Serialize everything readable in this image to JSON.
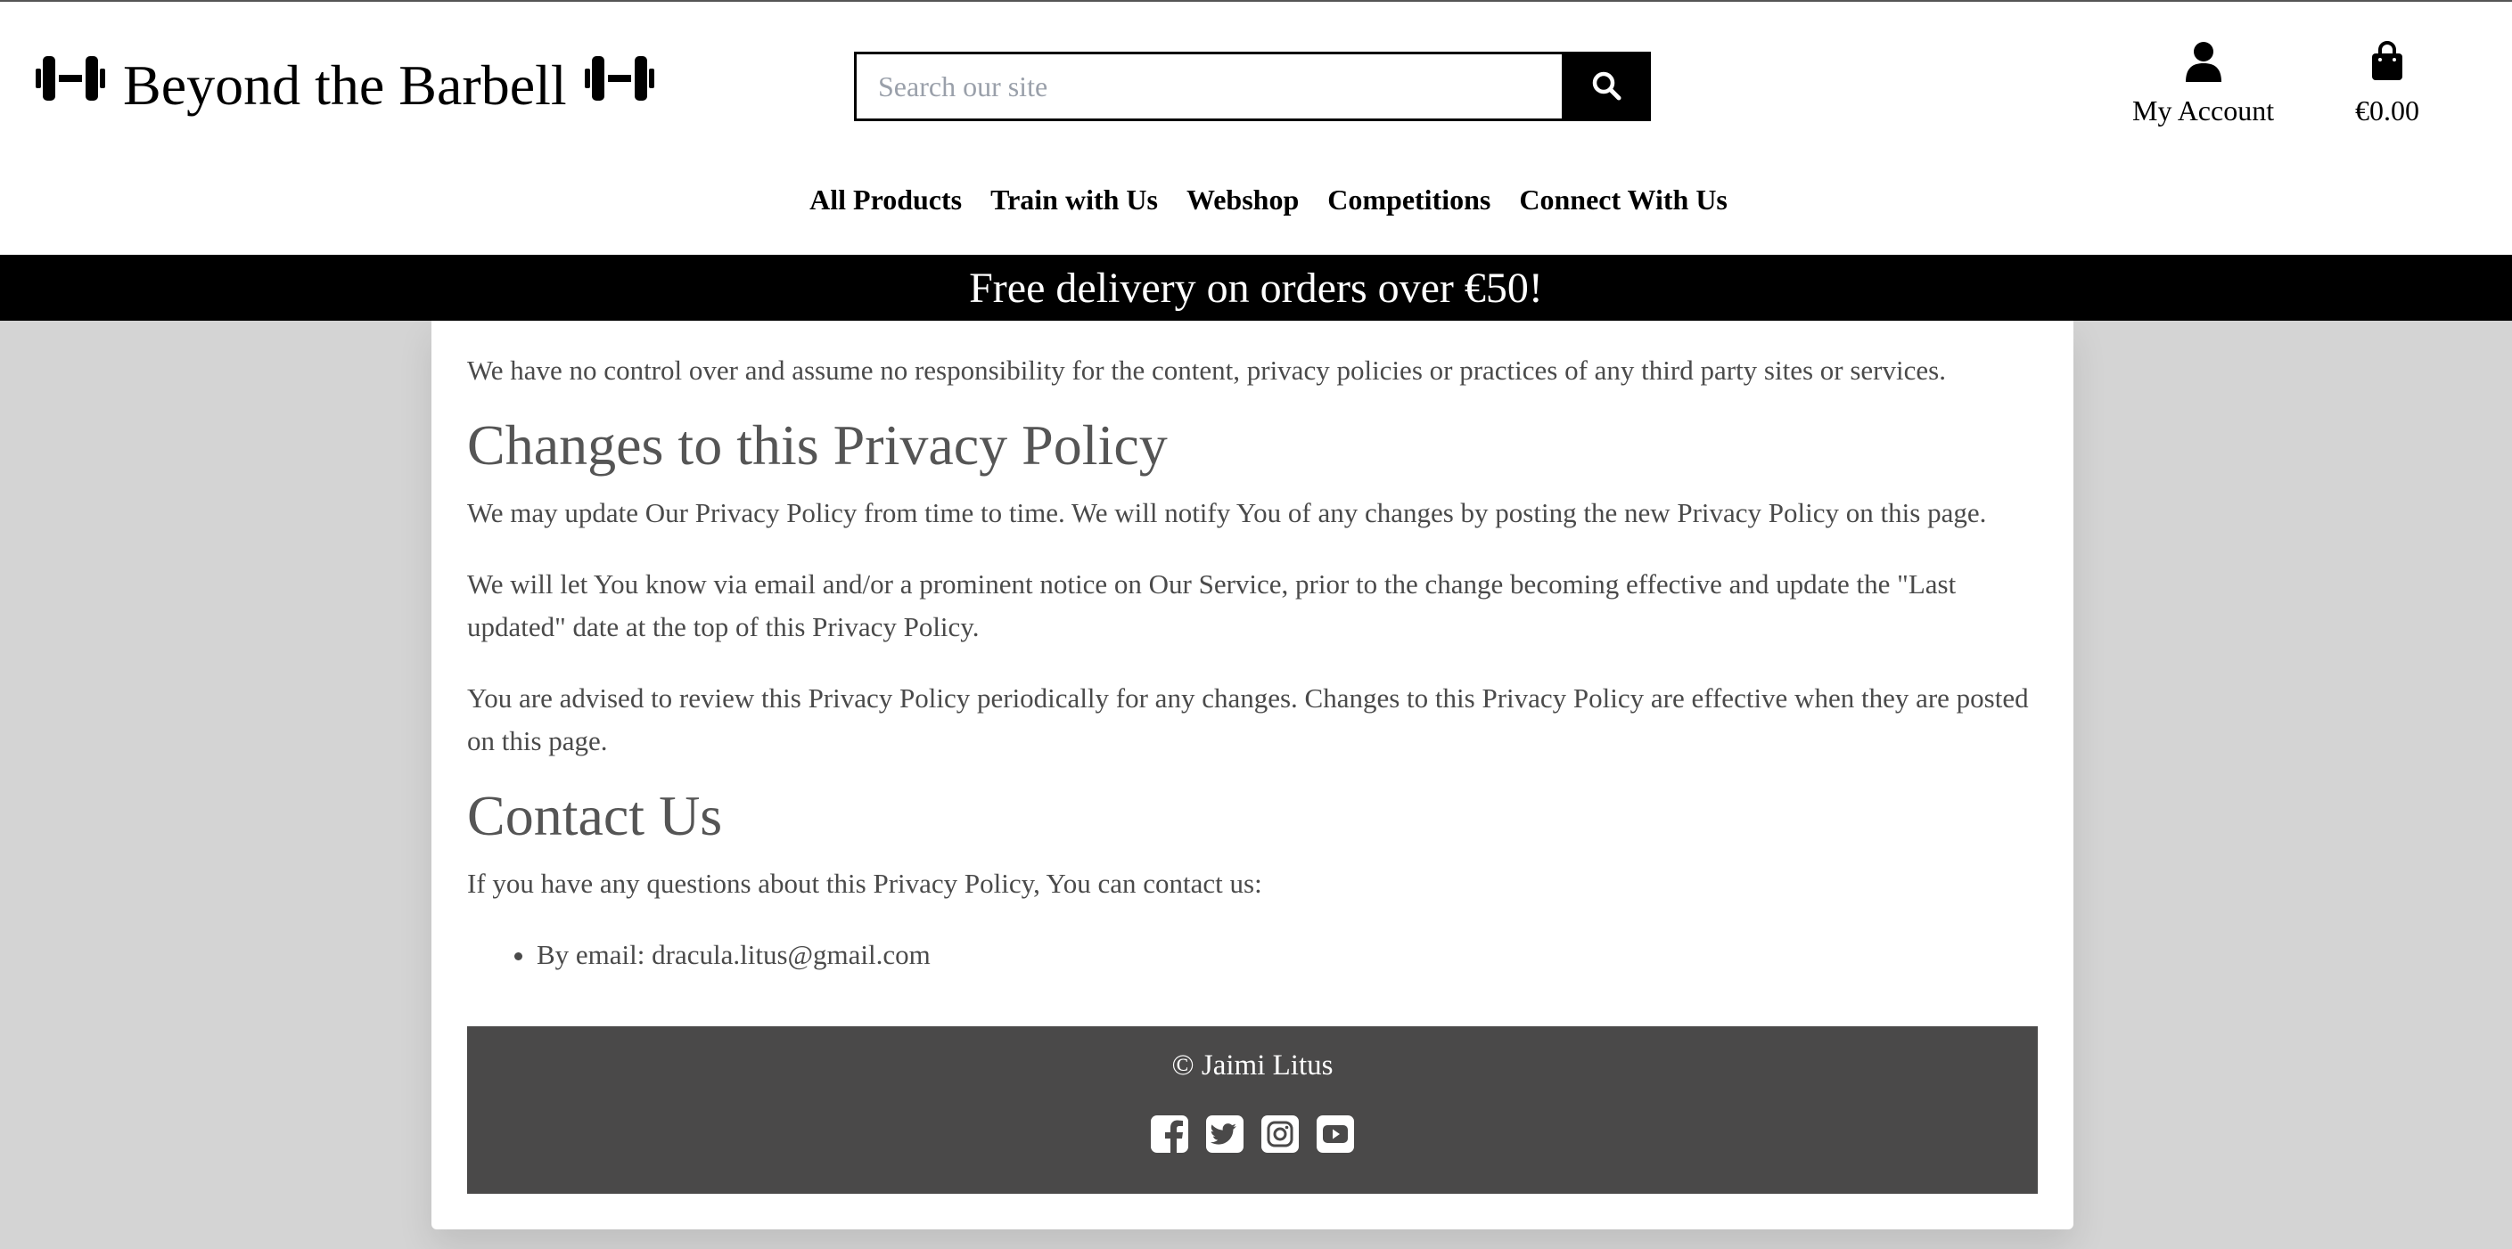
{
  "header": {
    "brand": "Beyond the Barbell",
    "search_placeholder": "Search our site",
    "account_label": "My Account",
    "cart_total": "€0.00"
  },
  "nav": {
    "items": [
      "All Products",
      "Train with Us",
      "Webshop",
      "Competitions",
      "Connect With Us"
    ]
  },
  "banner": "Free delivery on orders over €50!",
  "content": {
    "intro": "We have no control over and assume no responsibility for the content, privacy policies or practices of any third party sites or services.",
    "changes_heading": "Changes to this Privacy Policy",
    "changes_p1": "We may update Our Privacy Policy from time to time. We will notify You of any changes by posting the new Privacy Policy on this page.",
    "changes_p2": "We will let You know via email and/or a prominent notice on Our Service, prior to the change becoming effective and update the \"Last updated\" date at the top of this Privacy Policy.",
    "changes_p3": "You are advised to review this Privacy Policy periodically for any changes. Changes to this Privacy Policy are effective when they are posted on this page.",
    "contact_heading": "Contact Us",
    "contact_p": "If you have any questions about this Privacy Policy, You can contact us:",
    "contact_items": [
      "By email: dracula.litus@gmail.com"
    ]
  },
  "footer": {
    "copyright": "© Jaimi Litus",
    "socials": [
      "facebook-icon",
      "twitter-icon",
      "instagram-icon",
      "youtube-icon"
    ]
  },
  "colors": {
    "page_bg": "#d4d4d4",
    "banner_bg": "#000000",
    "footer_bg": "#4a4949",
    "body_text": "#4a4a4a"
  }
}
